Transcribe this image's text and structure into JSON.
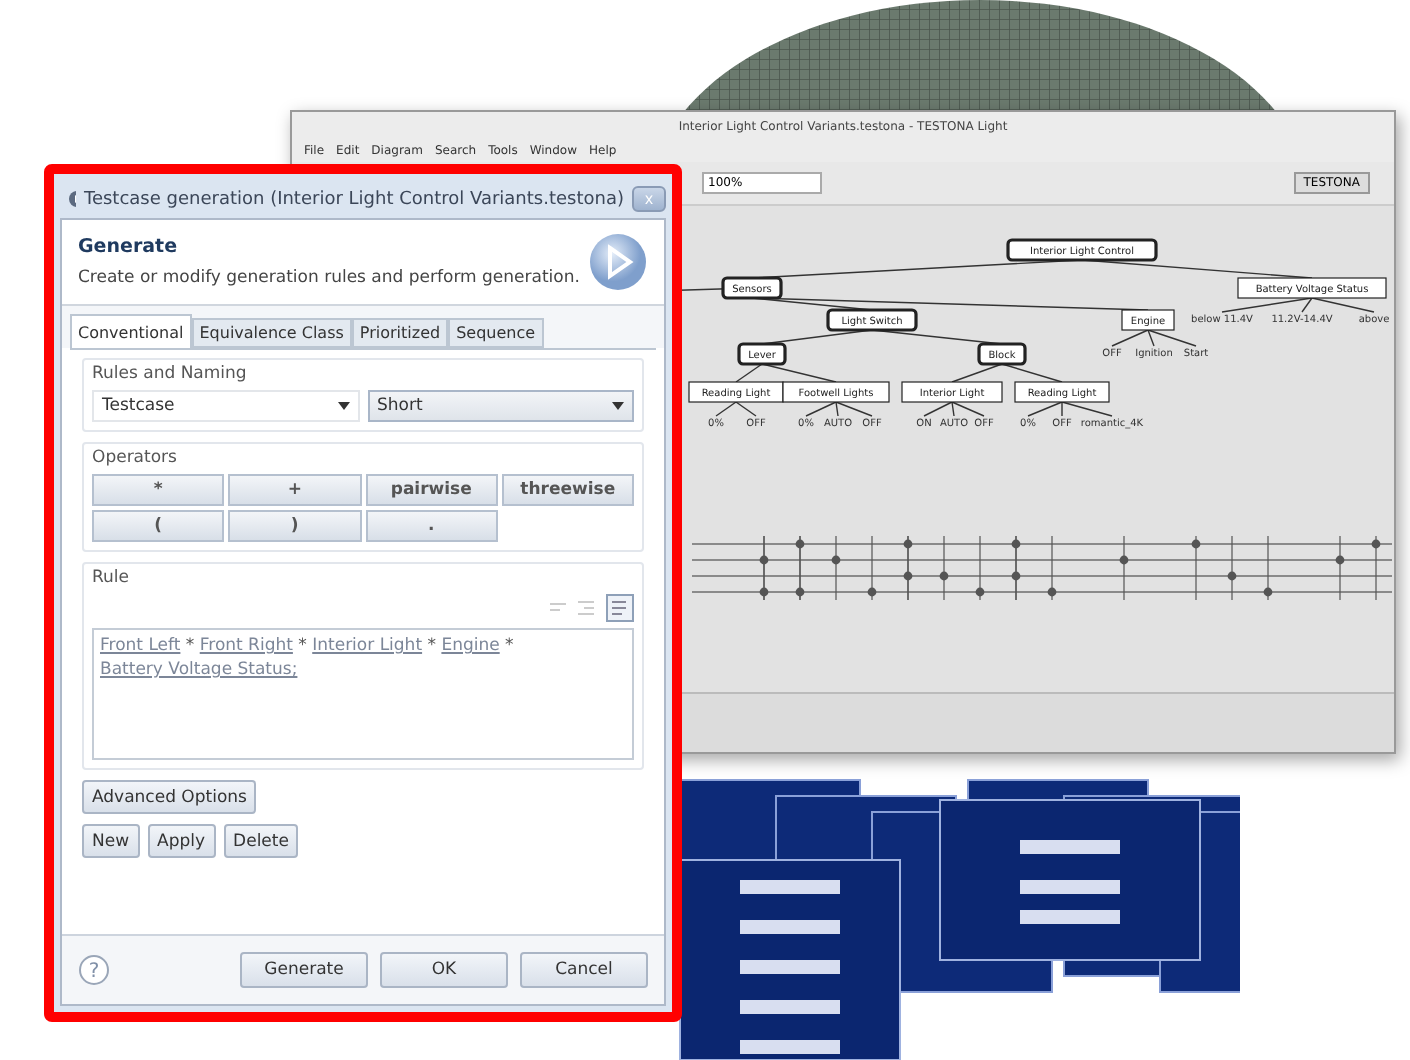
{
  "main_window": {
    "title": "Interior Light Control Variants.testona - TESTONA Light",
    "menu": [
      "File",
      "Edit",
      "Diagram",
      "Search",
      "Tools",
      "Window",
      "Help"
    ],
    "zoom": "100%",
    "perspective": "TESTONA",
    "tree": {
      "label": "Interior Light Control",
      "bold": true,
      "children": [
        {
          "label": "Sensors",
          "bold": true,
          "children": [
            {
              "label": "Light Switch",
              "bold": true,
              "children": [
                {
                  "label": "Lever",
                  "bold": true,
                  "children": [
                    {
                      "label": "Reading Light",
                      "bold": false,
                      "children": [
                        {
                          "label": "0%"
                        },
                        {
                          "label": "OFF"
                        }
                      ]
                    },
                    {
                      "label": "Footwell Lights",
                      "bold": false,
                      "children": [
                        {
                          "label": "0%"
                        },
                        {
                          "label": "AUTO"
                        },
                        {
                          "label": "OFF"
                        }
                      ]
                    }
                  ]
                },
                {
                  "label": "Block",
                  "bold": true,
                  "children": [
                    {
                      "label": "Interior Light",
                      "bold": false,
                      "children": [
                        {
                          "label": "ON"
                        },
                        {
                          "label": "AUTO"
                        },
                        {
                          "label": "OFF"
                        }
                      ]
                    },
                    {
                      "label": "Reading Light",
                      "bold": false,
                      "children": [
                        {
                          "label": "0%"
                        },
                        {
                          "label": "OFF"
                        },
                        {
                          "label": "romantic_4K"
                        }
                      ]
                    }
                  ]
                }
              ]
            },
            {
              "label": "Engine",
              "bold": false,
              "children": [
                {
                  "label": "OFF"
                },
                {
                  "label": "Ignition"
                },
                {
                  "label": "Start"
                }
              ]
            }
          ]
        },
        {
          "label": "Battery Voltage Status",
          "bold": false,
          "children": [
            {
              "label": "below 11.4V"
            },
            {
              "label": "11.2V-14.4V"
            },
            {
              "label": "above"
            }
          ]
        }
      ]
    }
  },
  "dialog": {
    "title": "Testcase generation (Interior Light Control Variants.testona)",
    "close": "x",
    "heading": "Generate",
    "description": "Create or modify generation rules and perform generation.",
    "tabs": [
      {
        "label": "Conventional",
        "selected": true
      },
      {
        "label": "Equivalence Class",
        "selected": false
      },
      {
        "label": "Prioritized",
        "selected": false
      },
      {
        "label": "Sequence",
        "selected": false
      }
    ],
    "rules_and_naming": {
      "label": "Rules and Naming",
      "dropdowns": [
        {
          "value": "Testcase",
          "kind": "flat"
        },
        {
          "value": "Short",
          "kind": "raised"
        }
      ]
    },
    "operators": {
      "label": "Operators",
      "buttons": [
        "*",
        "+",
        "pairwise",
        "threewise",
        "(",
        ")",
        "."
      ]
    },
    "rule": {
      "label": "Rule",
      "tokens": [
        {
          "text": "Front Left",
          "kind": "term"
        },
        {
          "text": "*",
          "kind": "op"
        },
        {
          "text": "Front Right",
          "kind": "term"
        },
        {
          "text": "*",
          "kind": "op"
        },
        {
          "text": "Interior Light",
          "kind": "term"
        },
        {
          "text": "*",
          "kind": "op"
        },
        {
          "text": "Engine",
          "kind": "term"
        },
        {
          "text": "*",
          "kind": "op"
        },
        {
          "text": "Battery Voltage Status;",
          "kind": "term"
        }
      ]
    },
    "advanced_button": "Advanced Options",
    "rule_buttons": [
      "New",
      "Apply",
      "Delete"
    ],
    "help": "?",
    "footer_buttons": [
      "Generate",
      "OK",
      "Cancel"
    ]
  }
}
